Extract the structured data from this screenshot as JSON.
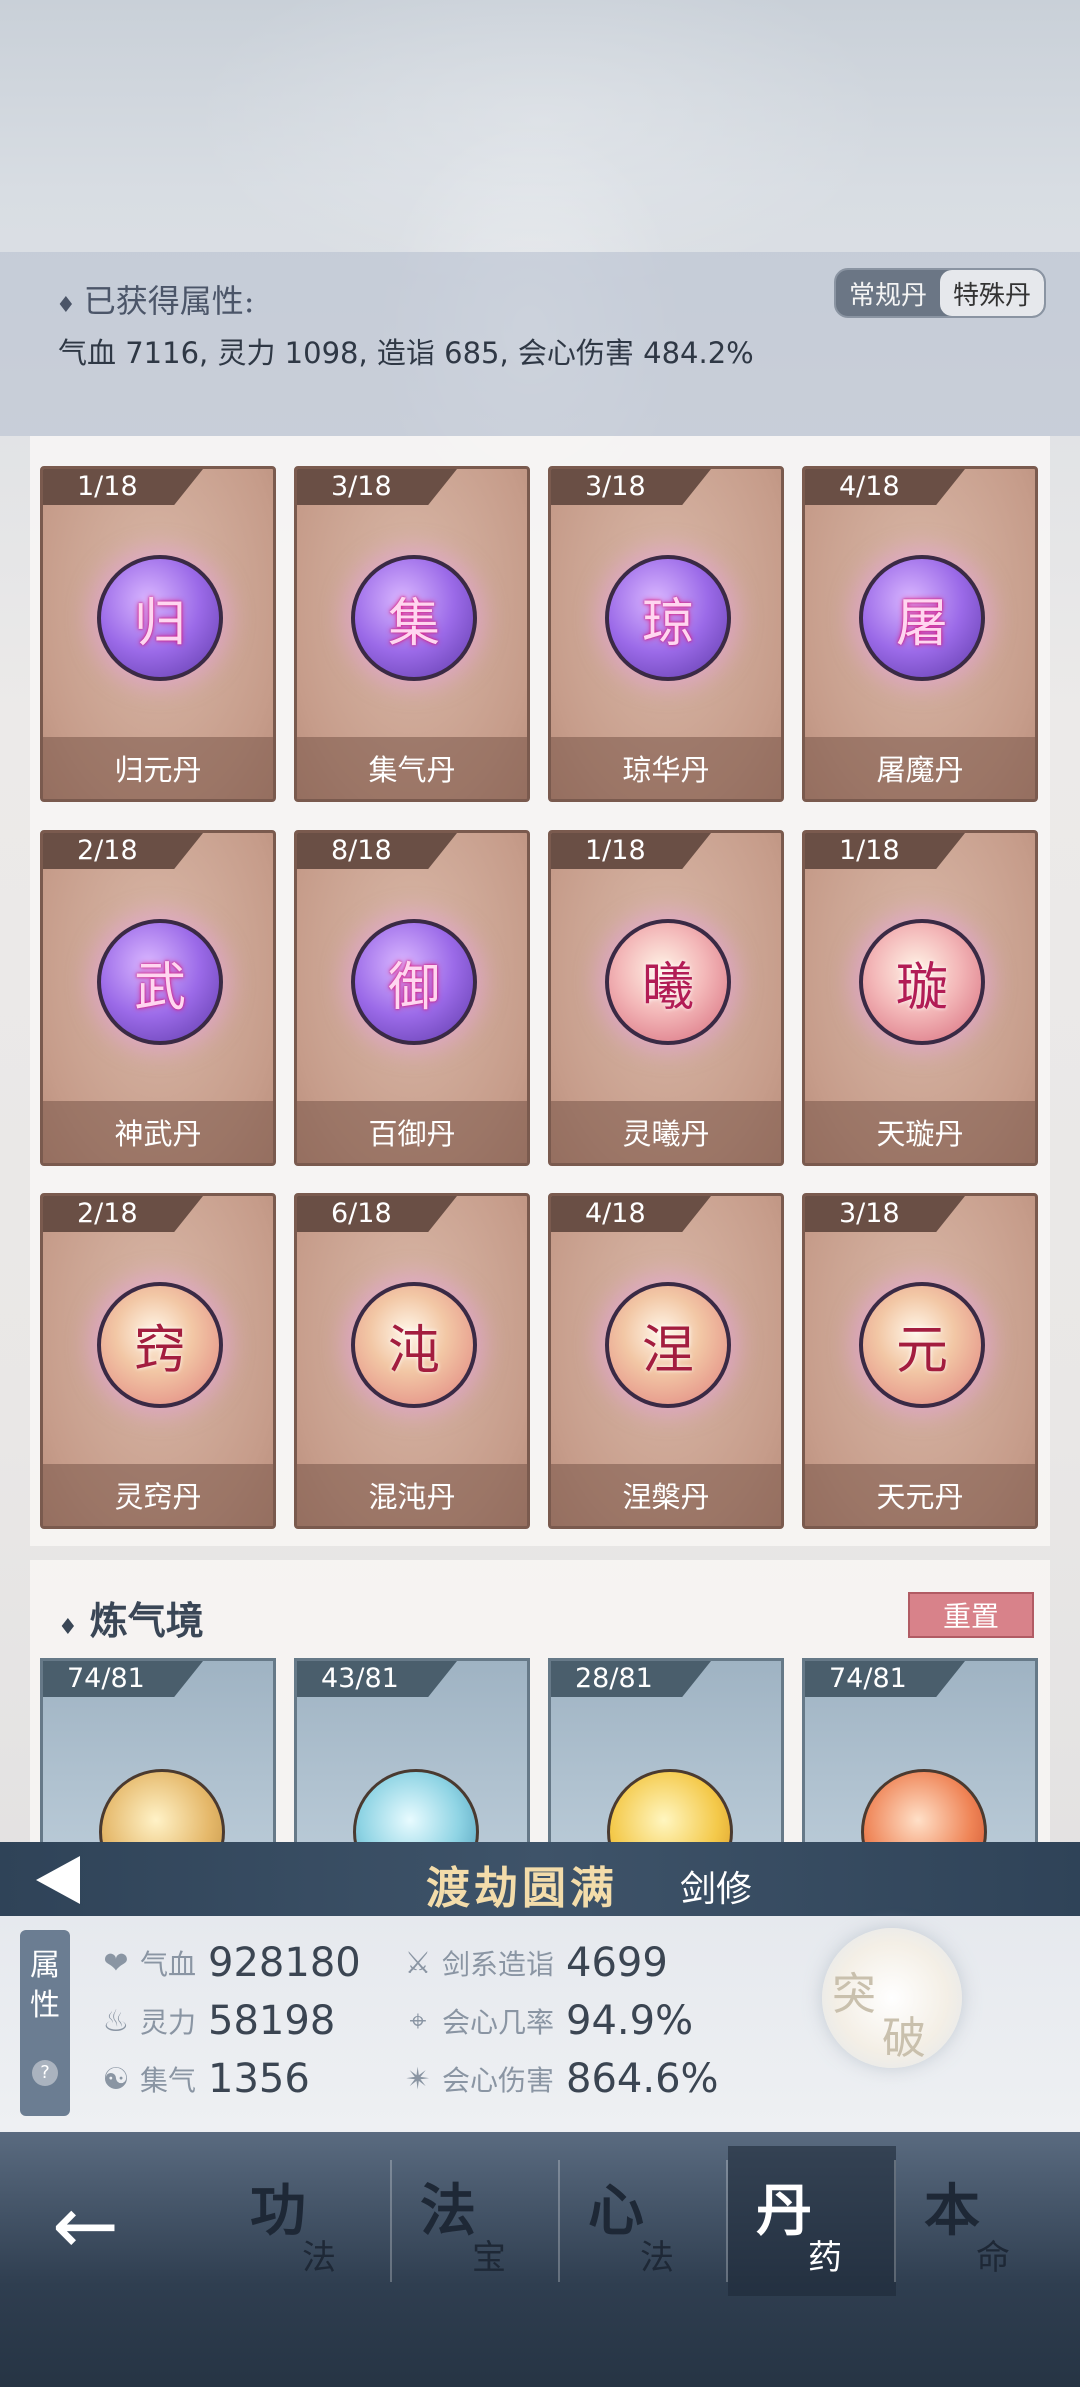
{
  "attributes_panel": {
    "title": "已获得属性:",
    "summary": "气血 7116, 灵力 1098, 造诣 685, 会心伤害 484.2%",
    "toggle": [
      "常规丹",
      "特殊丹"
    ]
  },
  "special_pills": [
    {
      "count": "1/18",
      "glyph": "归",
      "name": "归元丹",
      "style": "purple"
    },
    {
      "count": "3/18",
      "glyph": "集",
      "name": "集气丹",
      "style": "purple"
    },
    {
      "count": "3/18",
      "glyph": "琼",
      "name": "琼华丹",
      "style": "purple"
    },
    {
      "count": "4/18",
      "glyph": "屠",
      "name": "屠魔丹",
      "style": "purple"
    },
    {
      "count": "2/18",
      "glyph": "武",
      "name": "神武丹",
      "style": "purple"
    },
    {
      "count": "8/18",
      "glyph": "御",
      "name": "百御丹",
      "style": "purple"
    },
    {
      "count": "1/18",
      "glyph": "曦",
      "name": "灵曦丹",
      "style": "pink"
    },
    {
      "count": "1/18",
      "glyph": "璇",
      "name": "天璇丹",
      "style": "pink"
    },
    {
      "count": "2/18",
      "glyph": "窍",
      "name": "灵窍丹",
      "style": "rose"
    },
    {
      "count": "6/18",
      "glyph": "沌",
      "name": "混沌丹",
      "style": "rose"
    },
    {
      "count": "4/18",
      "glyph": "涅",
      "name": "涅槃丹",
      "style": "rose"
    },
    {
      "count": "3/18",
      "glyph": "元",
      "name": "天元丹",
      "style": "rose"
    }
  ],
  "section": {
    "title": "炼气境",
    "reset_label": "重置",
    "pills": [
      {
        "count": "74/81",
        "style": "gold"
      },
      {
        "count": "43/81",
        "style": "cyan"
      },
      {
        "count": "28/81",
        "style": "yellow"
      },
      {
        "count": "74/81",
        "style": "red"
      }
    ]
  },
  "status": {
    "realm": "渡劫圆满",
    "sect": "剑修",
    "side_label_1": "属",
    "side_label_2": "性",
    "help": "?",
    "stats": [
      {
        "icon": "heart-icon",
        "glyph": "❤",
        "label": "气血",
        "value": "928180"
      },
      {
        "icon": "sword-icon",
        "glyph": "⚔",
        "label": "剑系造诣",
        "value": "4699"
      },
      {
        "icon": "flame-icon",
        "glyph": "♨",
        "label": "灵力",
        "value": "58198"
      },
      {
        "icon": "target-icon",
        "glyph": "⌖",
        "label": "会心几率",
        "value": "94.9%"
      },
      {
        "icon": "swirl-icon",
        "glyph": "☯",
        "label": "集气",
        "value": "1356"
      },
      {
        "icon": "burst-icon",
        "glyph": "✴",
        "label": "会心伤害",
        "value": "864.6%"
      }
    ],
    "breakthrough_1": "突",
    "breakthrough_2": "破"
  },
  "nav": {
    "back": "←",
    "items": [
      {
        "big": "功",
        "small": "法",
        "active": false
      },
      {
        "big": "法",
        "small": "宝",
        "active": false
      },
      {
        "big": "心",
        "small": "法",
        "active": false
      },
      {
        "big": "丹",
        "small": "药",
        "active": true
      },
      {
        "big": "本",
        "small": "命",
        "active": false
      }
    ]
  }
}
